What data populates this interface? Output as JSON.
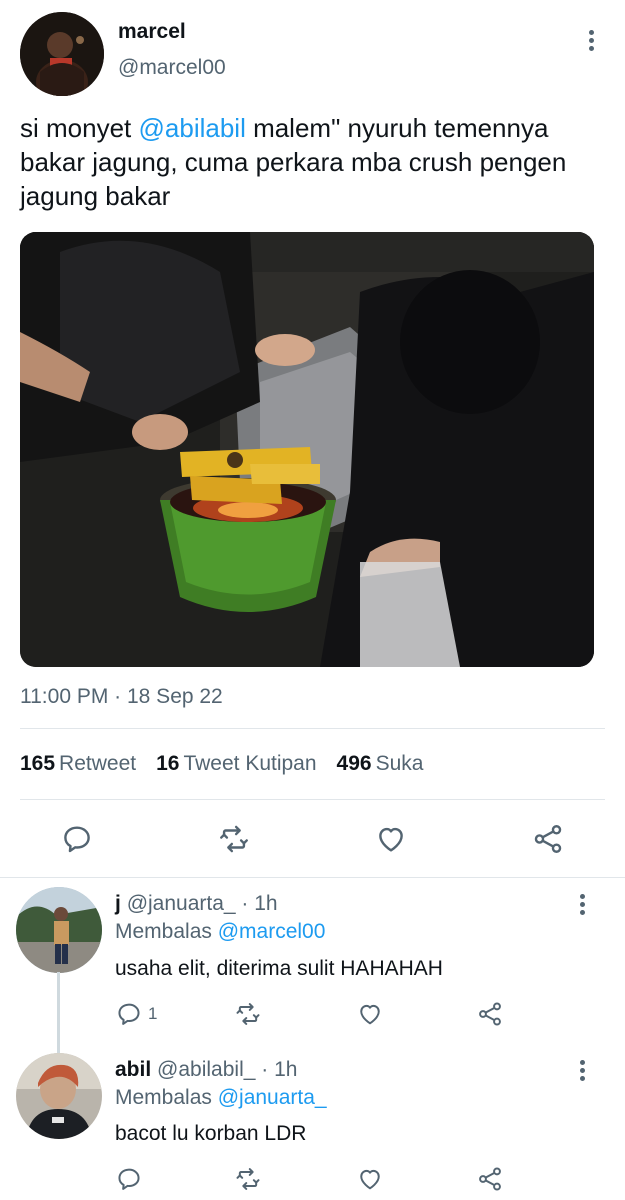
{
  "tweet": {
    "author_name": "marcel",
    "author_handle": "@marcel00",
    "text_before": "si monyet ",
    "mention": "@abilabil",
    "text_after": " malem\" nyuruh temennya bakar jagung, cuma perkara mba crush pengen jagung bakar",
    "timestamp": "11:00 PM · 18 Sep 22",
    "stats": {
      "retweets_count": "165",
      "retweets_label": "Retweet",
      "quotes_count": "16",
      "quotes_label": "Tweet Kutipan",
      "likes_count": "496",
      "likes_label": "Suka"
    },
    "actions": [
      "reply-icon",
      "retweet-icon",
      "like-icon",
      "share-icon"
    ]
  },
  "replies": [
    {
      "name": "j",
      "handle": "@januarta_",
      "time": "· 1h",
      "replying_prefix": "Membalas",
      "replying_to": "@marcel00",
      "text": "usaha elit, diterima sulit HAHAHAH",
      "reply_count": "1"
    },
    {
      "name": "abil",
      "handle": "@abilabil_",
      "time": "· 1h",
      "replying_prefix": "Membalas",
      "replying_to": "@januarta_",
      "text": "bacot lu korban LDR",
      "reply_count": ""
    }
  ],
  "colors": {
    "link": "#1d9bf0",
    "secondary_text": "#536471",
    "primary_text": "#0f1419",
    "divider": "#e1e6ea"
  }
}
